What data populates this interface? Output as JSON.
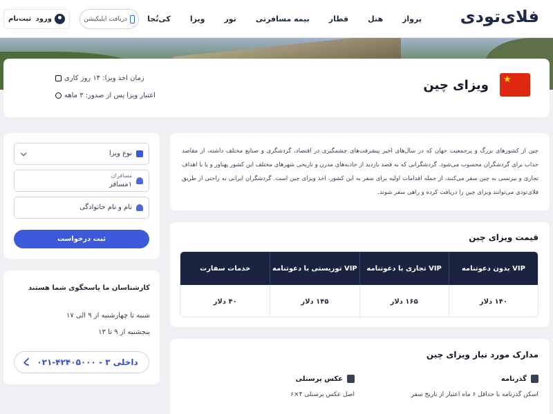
{
  "header": {
    "logo": "فلای‌تودی",
    "nav": [
      "پرواز",
      "هتل",
      "قطار",
      "بیمه مسافرتی",
      "تور",
      "ویزا",
      "کی‌تُجا"
    ],
    "app_button": "دریافت اپلیکیشن",
    "login": "ورود",
    "register": "ثبت‌نام"
  },
  "title_card": {
    "title": "ویزای چین",
    "processing_time": "زمان اخذ ویزا: ۱۴ روز کاری",
    "validity": "اعتبار ویزا پس از صدور: ۳ ماهه"
  },
  "form": {
    "visa_type_placeholder": "نوع ویزا",
    "passengers_label": "مسافران",
    "passengers_value": "۱مسافر",
    "name_placeholder": "نام و نام خانوادگی",
    "submit": "ثبت درخواست"
  },
  "contact": {
    "heading": "کارشناسان ما پاسخگوی شما هستند",
    "hours_1": "شنبه تا چهارشنبه از ۹ الی ۱۷",
    "hours_2": "پنجشنبه از ۹ تا ۱۳",
    "phone": "۰۲۱-۴۲۴۰۵۰۰۰ - داخلی ۳"
  },
  "description": "چین از کشورهای بزرگ و پرجمعیت جهان که در سال‌های اخیر پیشرفت‌های چشمگیری در اقتصاد، گردشگری و صنایع مختلف داشته، از مقاصد جذاب برای گردشگران محسوب می‌شود. گردشگرانی که به قصد بازدید از جاذبه‌های مدرن و تاریخی شهرهای مختلف این کشور پهناور و یا با اهداف تجاری و بیزنسی به چین سفر می‌کنند، از جمله اقدامات اولیه برای سفر به این کشور، اخذ ویزای چین است. گردشگران ایرانی به راحتی از طریق فلای‌تودی می‌توانند ویزای چین را دریافت کرده و راهی سفر شوند.",
  "prices": {
    "heading": "قیمت ویزای چین",
    "columns": [
      "VIP بدون دعوتنامه",
      "VIP تجاری با دعوتنامه",
      "VIP توریستی با دعوتنامه",
      "خدمات سفارت"
    ],
    "values": [
      "۱۴۰ دلار",
      "۱۶۵ دلار",
      "۱۴۵ دلار",
      "۴۰ دلار"
    ]
  },
  "documents": {
    "heading": "مدارک مورد نیاز ویزای چین",
    "passport_title": "گذرنامه",
    "passport_desc": "اسکن گذرنامه با حداقل ۶ ماه اعتبار از تاریخ سفر",
    "photo_title": "عکس پرسنلی",
    "photo_desc": "اصل عکس پرسنلی ۴×۶"
  },
  "colors": {
    "navy": "#1a2440",
    "primary": "#3b5bdb",
    "flag_red": "#de2910"
  }
}
